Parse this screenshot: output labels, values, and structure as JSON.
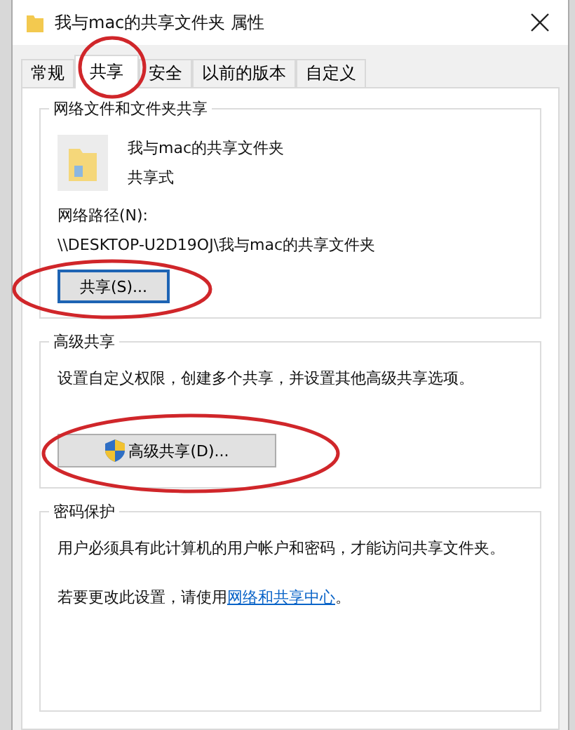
{
  "window": {
    "title": "我与mac的共享文件夹 属性"
  },
  "tabs": [
    {
      "label": "常规",
      "selected": false
    },
    {
      "label": "共享",
      "selected": true
    },
    {
      "label": "安全",
      "selected": false
    },
    {
      "label": "以前的版本",
      "selected": false
    },
    {
      "label": "自定义",
      "selected": false
    }
  ],
  "network_sharing": {
    "title": "网络文件和文件夹共享",
    "folder_name": "我与mac的共享文件夹",
    "folder_status": "共享式",
    "path_label": "网络路径(N):",
    "path": "\\\\DESKTOP-U2D19OJ\\我与mac的共享文件夹",
    "button": "共享(S)..."
  },
  "advanced_sharing": {
    "title": "高级共享",
    "description": "设置自定义权限，创建多个共享，并设置其他高级共享选项。",
    "button": "高级共享(D)..."
  },
  "password_protection": {
    "title": "密码保护",
    "description": "用户必须具有此计算机的用户帐户和密码，才能访问共享文件夹。",
    "hint_prefix": "若要更改此设置，请使用",
    "link": "网络和共享中心",
    "hint_suffix": "。"
  }
}
